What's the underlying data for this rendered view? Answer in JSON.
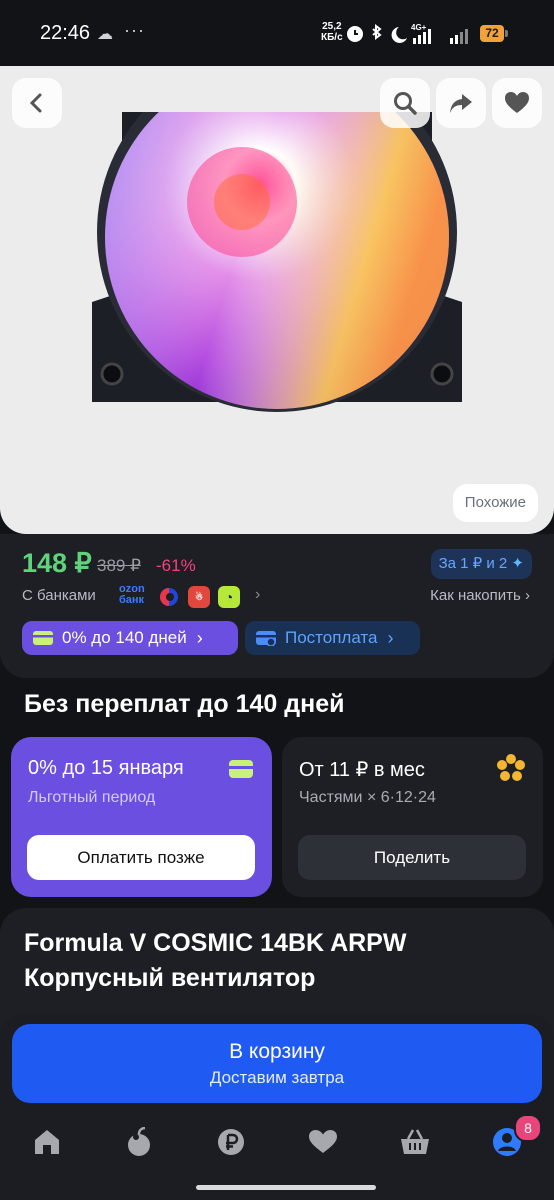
{
  "status_bar": {
    "time": "22:46",
    "dots": "···",
    "net_speed_value": "25,2",
    "net_speed_unit": "КБ/с",
    "network": "4G+",
    "battery": "72"
  },
  "product_image": {
    "similar_label": "Похожие"
  },
  "price": {
    "current": "148 ₽",
    "old": "389 ₽",
    "discount": "-61%",
    "points_badge": "За 1 ₽ и 2",
    "banks_label": "С банками",
    "ozon_bank_line1": "ozon",
    "ozon_bank_line2": "банк",
    "accumulate_label": "Как накопить ›"
  },
  "chips": {
    "installment_label": "0% до 140 дней",
    "postpay_label": "Постоплата"
  },
  "installments": {
    "section_title": "Без переплат до 140 дней",
    "card1": {
      "title": "0% до 15 января",
      "subtitle": "Льготный период",
      "button": "Оплатить позже"
    },
    "card2": {
      "title": "От 11 ₽ в мес",
      "subtitle": "Частями × 6·12·24",
      "button": "Поделить"
    }
  },
  "product": {
    "title": "Formula V COSMIC 14BK ARPW Корпусный вентилятор"
  },
  "cart": {
    "button_label": "В корзину",
    "delivery": "Доставим завтра"
  },
  "nav": {
    "profile_badge": "8"
  },
  "colors": {
    "background": "#121317",
    "card": "#1e1f25",
    "price_green": "#5ed37a",
    "discount_pink": "#f0437c",
    "accent_blue": "#1f5bf2",
    "installment_purple": "#6a4fe0"
  }
}
